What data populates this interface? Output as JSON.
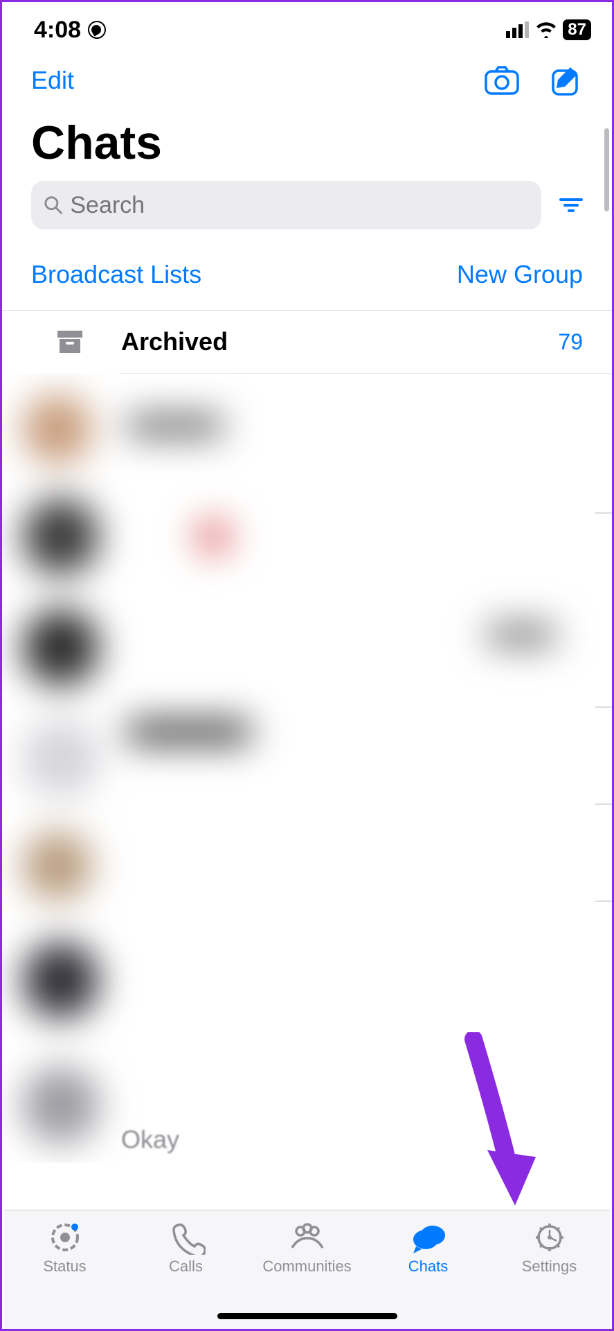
{
  "status_bar": {
    "time": "4:08",
    "battery": "87"
  },
  "nav": {
    "edit": "Edit"
  },
  "title": "Chats",
  "search": {
    "placeholder": "Search"
  },
  "quick": {
    "broadcast": "Broadcast Lists",
    "new_group": "New Group"
  },
  "archived": {
    "label": "Archived",
    "count": "79"
  },
  "partial_message": "Okay",
  "tabs": {
    "status": "Status",
    "calls": "Calls",
    "communities": "Communities",
    "chats": "Chats",
    "settings": "Settings"
  }
}
